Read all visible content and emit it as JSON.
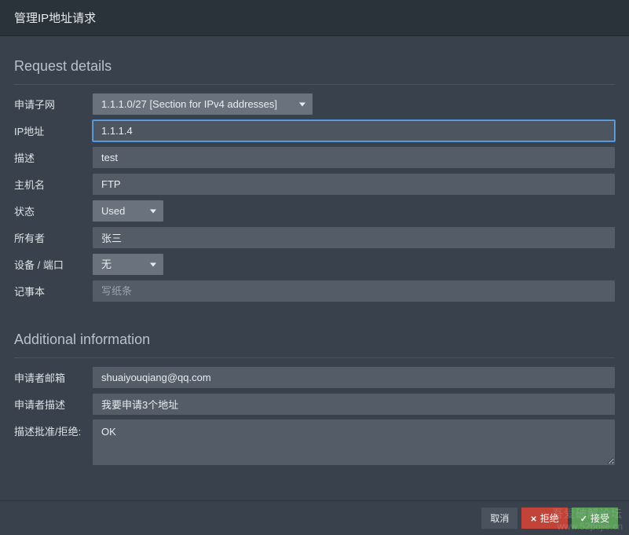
{
  "header": {
    "title": "管理IP地址请求"
  },
  "sections": {
    "request": {
      "title": "Request details",
      "fields": {
        "subnet": {
          "label": "申请子网",
          "value": "1.1.1.0/27 [Section for IPv4 addresses]"
        },
        "ip": {
          "label": "IP地址",
          "value": "1.1.1.4"
        },
        "description": {
          "label": "描述",
          "value": "test"
        },
        "hostname": {
          "label": "主机名",
          "value": "FTP"
        },
        "state": {
          "label": "状态",
          "value": "Used"
        },
        "owner": {
          "label": "所有者",
          "value": "张三"
        },
        "device_port": {
          "label": "设备 / 端口",
          "value": "无"
        },
        "note": {
          "label": "记事本",
          "placeholder": "写纸条",
          "value": ""
        }
      }
    },
    "additional": {
      "title": "Additional information",
      "fields": {
        "requester_email": {
          "label": "申请者邮箱",
          "value": "shuaiyouqiang@qq.com"
        },
        "requester_desc": {
          "label": "申请者描述",
          "value": "我要申请3个地址"
        },
        "approval_desc": {
          "label": "描述批准/拒绝:",
          "value": "OK"
        }
      }
    }
  },
  "footer": {
    "cancel": "取消",
    "reject": "拒绝",
    "accept": "接受"
  },
  "watermark": {
    "line1": "吾爱破解论坛",
    "line2": "www.52pojie.cn"
  }
}
